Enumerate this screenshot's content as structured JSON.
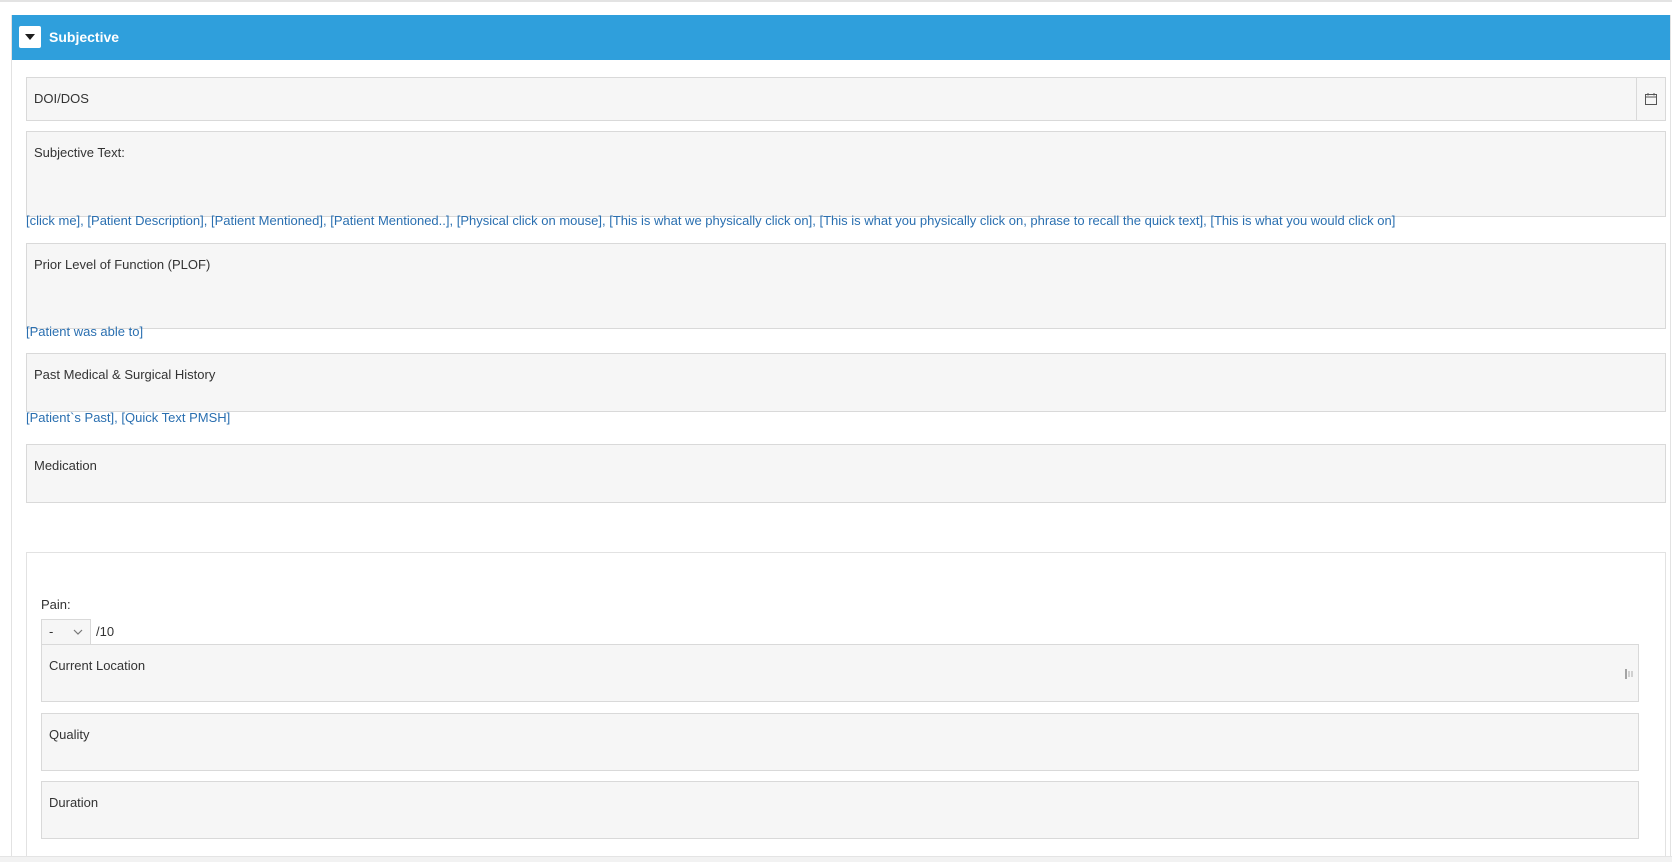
{
  "section": {
    "title": "Subjective",
    "toggle_icon": "caret-down-icon",
    "header_color": "#2f9fdc"
  },
  "fields": {
    "doi_dos": {
      "label": "DOI/DOS",
      "icon": "calendar-icon"
    },
    "subjective_text": {
      "label": "Subjective Text:"
    },
    "plof": {
      "label": "Prior Level of Function (PLOF)"
    },
    "pmsh": {
      "label": "Past Medical & Surgical History"
    },
    "medication": {
      "label": "Medication"
    }
  },
  "quick_links": {
    "subjective": [
      "[click me]",
      "[Patient Description]",
      "[Patient Mentioned]",
      "[Patient Mentioned..]",
      "[Physical click on mouse]",
      "[This is what we physically click on]",
      "[This is what you physically click on, phrase to recall the quick text]",
      "[This is what you would click on]"
    ],
    "plof": [
      "[Patient was able to]"
    ],
    "pmsh": [
      "[Patient`s Past]",
      "[Quick Text PMSH]"
    ],
    "link_color": "#2a6fb0"
  },
  "pain": {
    "label": "Pain:",
    "selected": "-",
    "suffix": "/10",
    "current_location": "Current Location",
    "quality": "Quality",
    "duration": "Duration"
  }
}
